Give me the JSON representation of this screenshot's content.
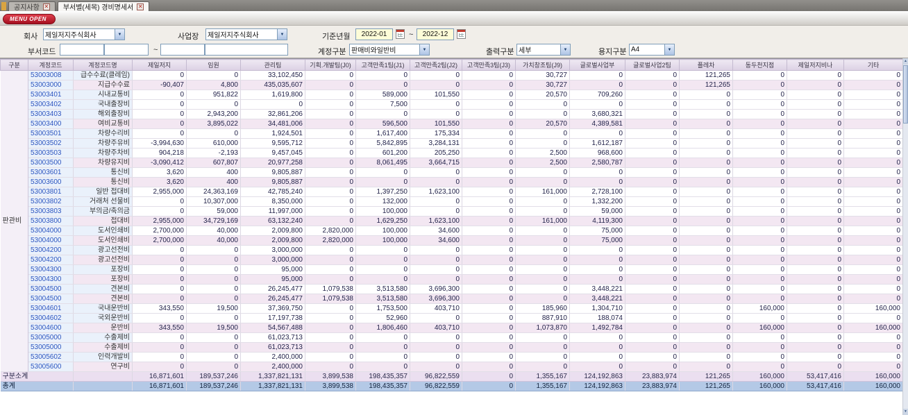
{
  "window": {
    "tabs": [
      {
        "label": "공지사항"
      },
      {
        "label": "부서별(세목) 경비명세서"
      }
    ],
    "menu_open_label": "MENU OPEN"
  },
  "filters": {
    "company_label": "회사",
    "company_value": "제일저지주식회사",
    "site_label": "사업장",
    "site_value": "제일저지주식회사",
    "period_label": "기준년월",
    "period_from": "2022-01",
    "period_to": "2022-12",
    "range_separator": "~",
    "dept_code_label": "부서코드",
    "dept_from": "",
    "dept_from_name": "",
    "dept_to": "",
    "dept_to_name": "",
    "account_label": "계정구분",
    "account_value": "판매비와일반비",
    "output_label": "출력구분",
    "output_value": "세부",
    "paper_label": "용지구분",
    "paper_value": "A4"
  },
  "table": {
    "columns": [
      "구분",
      "계정코드",
      "계정코드명",
      "제일저지",
      "임원",
      "관리팀",
      "기획.개발팀(J0)",
      "고객만족1팀(J1)",
      "고객만족2팀(J2)",
      "고객만족3팀(J3)",
      "가치창조팀(J9)",
      "글로벌사업부",
      "글로벌사업2팀",
      "플레차",
      "동두천지점",
      "제일저지비나",
      "기타"
    ],
    "group_label": "판관비",
    "rows": [
      {
        "code": "53003008",
        "name": "급수수료(클레임)",
        "subtotal": false,
        "values": [
          "0",
          "0",
          "33,102,450",
          "0",
          "0",
          "0",
          "0",
          "30,727",
          "0",
          "0",
          "121,265",
          "0",
          "0",
          "0"
        ]
      },
      {
        "code": "53003000",
        "name": "지급수수료",
        "subtotal": true,
        "values": [
          "-90,407",
          "4,800",
          "435,035,607",
          "0",
          "0",
          "0",
          "0",
          "30,727",
          "0",
          "0",
          "121,265",
          "0",
          "0",
          "0"
        ]
      },
      {
        "code": "53003401",
        "name": "시내교통비",
        "subtotal": false,
        "values": [
          "0",
          "951,822",
          "1,619,800",
          "0",
          "589,000",
          "101,550",
          "0",
          "20,570",
          "709,260",
          "0",
          "0",
          "0",
          "0",
          "0"
        ]
      },
      {
        "code": "53003402",
        "name": "국내출장비",
        "subtotal": false,
        "values": [
          "0",
          "0",
          "0",
          "0",
          "7,500",
          "0",
          "0",
          "0",
          "0",
          "0",
          "0",
          "0",
          "0",
          "0"
        ]
      },
      {
        "code": "53003403",
        "name": "해외출장비",
        "subtotal": false,
        "values": [
          "0",
          "2,943,200",
          "32,861,206",
          "0",
          "0",
          "0",
          "0",
          "0",
          "3,680,321",
          "0",
          "0",
          "0",
          "0",
          "0"
        ]
      },
      {
        "code": "53003400",
        "name": "여비교통비",
        "subtotal": true,
        "values": [
          "0",
          "3,895,022",
          "34,481,006",
          "0",
          "596,500",
          "101,550",
          "0",
          "20,570",
          "4,389,581",
          "0",
          "0",
          "0",
          "0",
          "0"
        ]
      },
      {
        "code": "53003501",
        "name": "차량수리비",
        "subtotal": false,
        "values": [
          "0",
          "0",
          "1,924,501",
          "0",
          "1,617,400",
          "175,334",
          "0",
          "0",
          "0",
          "0",
          "0",
          "0",
          "0",
          "0"
        ]
      },
      {
        "code": "53003502",
        "name": "차량주유비",
        "subtotal": false,
        "values": [
          "-3,994,630",
          "610,000",
          "9,595,712",
          "0",
          "5,842,895",
          "3,284,131",
          "0",
          "0",
          "1,612,187",
          "0",
          "0",
          "0",
          "0",
          "0"
        ]
      },
      {
        "code": "53003503",
        "name": "차량주차비",
        "subtotal": false,
        "values": [
          "904,218",
          "-2,193",
          "9,457,045",
          "0",
          "601,200",
          "205,250",
          "0",
          "2,500",
          "968,600",
          "0",
          "0",
          "0",
          "0",
          "0"
        ]
      },
      {
        "code": "53003500",
        "name": "차량유지비",
        "subtotal": true,
        "values": [
          "-3,090,412",
          "607,807",
          "20,977,258",
          "0",
          "8,061,495",
          "3,664,715",
          "0",
          "2,500",
          "2,580,787",
          "0",
          "0",
          "0",
          "0",
          "0"
        ]
      },
      {
        "code": "53003601",
        "name": "통신비",
        "subtotal": false,
        "values": [
          "3,620",
          "400",
          "9,805,887",
          "0",
          "0",
          "0",
          "0",
          "0",
          "0",
          "0",
          "0",
          "0",
          "0",
          "0"
        ]
      },
      {
        "code": "53003600",
        "name": "통신비",
        "subtotal": true,
        "values": [
          "3,620",
          "400",
          "9,805,887",
          "0",
          "0",
          "0",
          "0",
          "0",
          "0",
          "0",
          "0",
          "0",
          "0",
          "0"
        ]
      },
      {
        "code": "53003801",
        "name": "일반 접대비",
        "subtotal": false,
        "values": [
          "2,955,000",
          "24,363,169",
          "42,785,240",
          "0",
          "1,397,250",
          "1,623,100",
          "0",
          "161,000",
          "2,728,100",
          "0",
          "0",
          "0",
          "0",
          "0"
        ]
      },
      {
        "code": "53003802",
        "name": "거래처 선물비",
        "subtotal": false,
        "values": [
          "0",
          "10,307,000",
          "8,350,000",
          "0",
          "132,000",
          "0",
          "0",
          "0",
          "1,332,200",
          "0",
          "0",
          "0",
          "0",
          "0"
        ]
      },
      {
        "code": "53003803",
        "name": "부의금/축의금",
        "subtotal": false,
        "values": [
          "0",
          "59,000",
          "11,997,000",
          "0",
          "100,000",
          "0",
          "0",
          "0",
          "59,000",
          "0",
          "0",
          "0",
          "0",
          "0"
        ]
      },
      {
        "code": "53003800",
        "name": "접대비",
        "subtotal": true,
        "values": [
          "2,955,000",
          "34,729,169",
          "63,132,240",
          "0",
          "1,629,250",
          "1,623,100",
          "0",
          "161,000",
          "4,119,300",
          "0",
          "0",
          "0",
          "0",
          "0"
        ]
      },
      {
        "code": "53004000",
        "name": "도서인쇄비",
        "subtotal": false,
        "values": [
          "2,700,000",
          "40,000",
          "2,009,800",
          "2,820,000",
          "100,000",
          "34,600",
          "0",
          "0",
          "75,000",
          "0",
          "0",
          "0",
          "0",
          "0"
        ]
      },
      {
        "code": "53004000",
        "name": "도서인쇄비",
        "subtotal": true,
        "values": [
          "2,700,000",
          "40,000",
          "2,009,800",
          "2,820,000",
          "100,000",
          "34,600",
          "0",
          "0",
          "75,000",
          "0",
          "0",
          "0",
          "0",
          "0"
        ]
      },
      {
        "code": "53004200",
        "name": "광고선전비",
        "subtotal": false,
        "values": [
          "0",
          "0",
          "3,000,000",
          "0",
          "0",
          "0",
          "0",
          "0",
          "0",
          "0",
          "0",
          "0",
          "0",
          "0"
        ]
      },
      {
        "code": "53004200",
        "name": "광고선전비",
        "subtotal": true,
        "values": [
          "0",
          "0",
          "3,000,000",
          "0",
          "0",
          "0",
          "0",
          "0",
          "0",
          "0",
          "0",
          "0",
          "0",
          "0"
        ]
      },
      {
        "code": "53004300",
        "name": "포장비",
        "subtotal": false,
        "values": [
          "0",
          "0",
          "95,000",
          "0",
          "0",
          "0",
          "0",
          "0",
          "0",
          "0",
          "0",
          "0",
          "0",
          "0"
        ]
      },
      {
        "code": "53004300",
        "name": "포장비",
        "subtotal": true,
        "values": [
          "0",
          "0",
          "95,000",
          "0",
          "0",
          "0",
          "0",
          "0",
          "0",
          "0",
          "0",
          "0",
          "0",
          "0"
        ]
      },
      {
        "code": "53004500",
        "name": "견본비",
        "subtotal": false,
        "values": [
          "0",
          "0",
          "26,245,477",
          "1,079,538",
          "3,513,580",
          "3,696,300",
          "0",
          "0",
          "3,448,221",
          "0",
          "0",
          "0",
          "0",
          "0"
        ]
      },
      {
        "code": "53004500",
        "name": "견본비",
        "subtotal": true,
        "values": [
          "0",
          "0",
          "26,245,477",
          "1,079,538",
          "3,513,580",
          "3,696,300",
          "0",
          "0",
          "3,448,221",
          "0",
          "0",
          "0",
          "0",
          "0"
        ]
      },
      {
        "code": "53004601",
        "name": "국내운반비",
        "subtotal": false,
        "values": [
          "343,550",
          "19,500",
          "37,369,750",
          "0",
          "1,753,500",
          "403,710",
          "0",
          "185,960",
          "1,304,710",
          "0",
          "0",
          "160,000",
          "0",
          "160,000"
        ]
      },
      {
        "code": "53004602",
        "name": "국외운반비",
        "subtotal": false,
        "values": [
          "0",
          "0",
          "17,197,738",
          "0",
          "52,960",
          "0",
          "0",
          "887,910",
          "188,074",
          "0",
          "0",
          "0",
          "0",
          "0"
        ]
      },
      {
        "code": "53004600",
        "name": "운반비",
        "subtotal": true,
        "values": [
          "343,550",
          "19,500",
          "54,567,488",
          "0",
          "1,806,460",
          "403,710",
          "0",
          "1,073,870",
          "1,492,784",
          "0",
          "0",
          "160,000",
          "0",
          "160,000"
        ]
      },
      {
        "code": "53005000",
        "name": "수출제비",
        "subtotal": false,
        "values": [
          "0",
          "0",
          "61,023,713",
          "0",
          "0",
          "0",
          "0",
          "0",
          "0",
          "0",
          "0",
          "0",
          "0",
          "0"
        ]
      },
      {
        "code": "53005000",
        "name": "수출제비",
        "subtotal": true,
        "values": [
          "0",
          "0",
          "61,023,713",
          "0",
          "0",
          "0",
          "0",
          "0",
          "0",
          "0",
          "0",
          "0",
          "0",
          "0"
        ]
      },
      {
        "code": "53005602",
        "name": "인력개발비",
        "subtotal": false,
        "values": [
          "0",
          "0",
          "2,400,000",
          "0",
          "0",
          "0",
          "0",
          "0",
          "0",
          "0",
          "0",
          "0",
          "0",
          "0"
        ]
      },
      {
        "code": "53005600",
        "name": "연구비",
        "subtotal": true,
        "values": [
          "0",
          "0",
          "2,400,000",
          "0",
          "0",
          "0",
          "0",
          "0",
          "0",
          "0",
          "0",
          "0",
          "0",
          "0"
        ]
      }
    ],
    "subtotal_row": {
      "label": "구분소계",
      "values": [
        "16,871,601",
        "189,537,246",
        "1,337,821,131",
        "3,899,538",
        "198,435,357",
        "96,822,559",
        "0",
        "1,355,167",
        "124,192,863",
        "23,883,974",
        "121,265",
        "160,000",
        "53,417,416",
        "160,000"
      ]
    },
    "total_row": {
      "label": "총계",
      "values": [
        "16,871,601",
        "189,537,246",
        "1,337,821,131",
        "3,899,538",
        "198,435,357",
        "96,822,559",
        "0",
        "1,355,167",
        "124,192,863",
        "23,883,974",
        "121,265",
        "160,000",
        "53,417,416",
        "160,000"
      ]
    }
  }
}
